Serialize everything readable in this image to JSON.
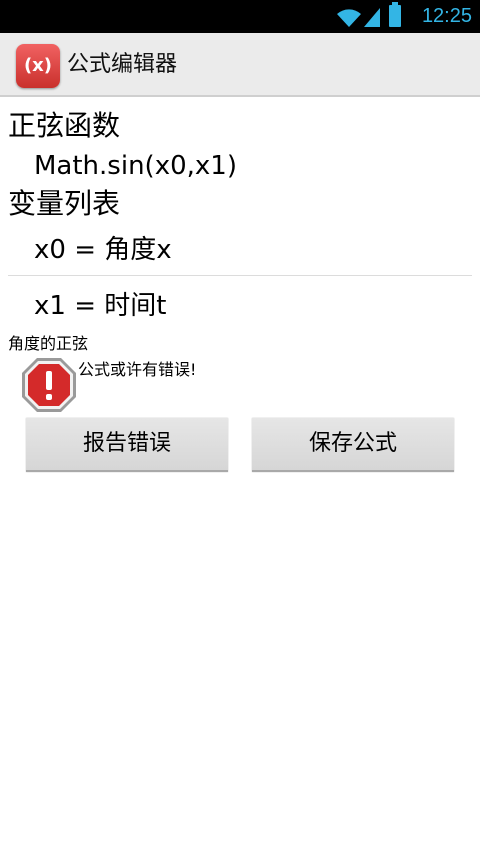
{
  "status_bar": {
    "time": "12:25",
    "icons": [
      "wifi-icon",
      "signal-icon",
      "battery-icon"
    ],
    "accent_color": "#33b5e5"
  },
  "action_bar": {
    "app_icon_text": "(x)",
    "title": "公式编辑器",
    "icon_color": "#e0433c"
  },
  "formula": {
    "section_title": "正弦函数",
    "expression": "Math.sin(x0,x1)"
  },
  "variables": {
    "section_title": "变量列表",
    "items": [
      {
        "label": "x0 = 角度x"
      },
      {
        "label": "x1 = 时间t"
      }
    ]
  },
  "description": "角度的正弦",
  "warning": {
    "icon": "warning-stop-icon",
    "message": "公式或许有错误!"
  },
  "buttons": {
    "report": "报告错误",
    "save": "保存公式"
  }
}
